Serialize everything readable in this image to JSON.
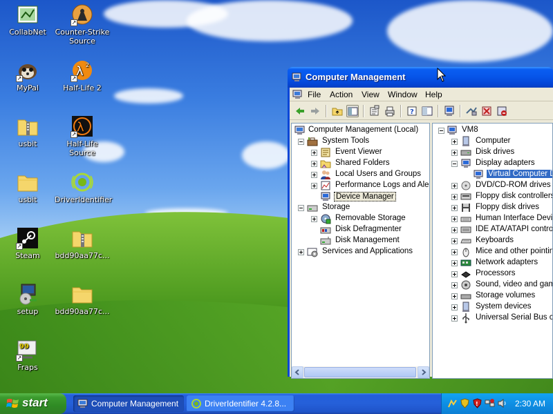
{
  "desktop": {
    "icons": [
      {
        "label": "CollabNet",
        "icon": "collabnet-icon"
      },
      {
        "label": "Counter-Strike Source",
        "icon": "counter-strike-icon"
      },
      {
        "label": "MyPal",
        "icon": "mypal-icon"
      },
      {
        "label": "Half-Life 2",
        "icon": "half-life-2-icon"
      },
      {
        "label": "usbit",
        "icon": "zip-folder-icon"
      },
      {
        "label": "Half-Life Source",
        "icon": "half-life-source-icon"
      },
      {
        "label": "usbit",
        "icon": "folder-icon"
      },
      {
        "label": "DriverIdentifier",
        "icon": "driveridentifier-icon"
      },
      {
        "label": "Steam",
        "icon": "steam-icon"
      },
      {
        "label": "bdd90aa77c...",
        "icon": "zip-folder-icon"
      },
      {
        "label": "setup",
        "icon": "setup-icon"
      },
      {
        "label": "bdd90aa77c...",
        "icon": "folder-icon"
      },
      {
        "label": "Fraps",
        "icon": "fraps-icon"
      }
    ]
  },
  "window": {
    "title": "Computer Management",
    "menu": [
      "File",
      "Action",
      "View",
      "Window",
      "Help"
    ],
    "toolbar_icons": [
      "back-icon",
      "forward-icon",
      "up-folder-icon",
      "show-tree-icon",
      "properties-icon",
      "print-icon",
      "help-icon",
      "export-list-icon",
      "scan-hardware-icon",
      "update-driver-icon",
      "uninstall-icon",
      "disable-icon"
    ],
    "tree": {
      "root": "Computer Management (Local)",
      "system_tools": "System Tools",
      "event_viewer": "Event Viewer",
      "shared_folders": "Shared Folders",
      "local_users": "Local Users and Groups",
      "perf_logs": "Performance Logs and Alerts",
      "device_manager": "Device Manager",
      "storage": "Storage",
      "removable_storage": "Removable Storage",
      "disk_defrag": "Disk Defragmenter",
      "disk_mgmt": "Disk Management",
      "services": "Services and Applications"
    },
    "devices": {
      "root": "VM8",
      "computer": "Computer",
      "disk_drives": "Disk drives",
      "display_adapters": "Display adapters",
      "virtual_display": "Virtual Computer Dis",
      "dvd": "DVD/CD-ROM drives",
      "floppy_ctrl": "Floppy disk controllers",
      "floppy_drives": "Floppy disk drives",
      "hid": "Human Interface Device",
      "ide": "IDE ATA/ATAPI controlle",
      "keyboards": "Keyboards",
      "mice": "Mice and other pointing",
      "network": "Network adapters",
      "processors": "Processors",
      "sound": "Sound, video and game",
      "storage_volumes": "Storage volumes",
      "system_devices": "System devices",
      "usb": "Universal Serial Bus cont"
    }
  },
  "taskbar": {
    "start_label": "start",
    "tasks": [
      "Computer Management",
      "DriverIdentifier 4.2.8..."
    ],
    "clock": "2:30 AM"
  },
  "colors": {
    "selection": "#316ac5",
    "titlebar": "#0654e8",
    "start_green": "#3c9b2e",
    "tray_blue": "#0f8fe4"
  }
}
